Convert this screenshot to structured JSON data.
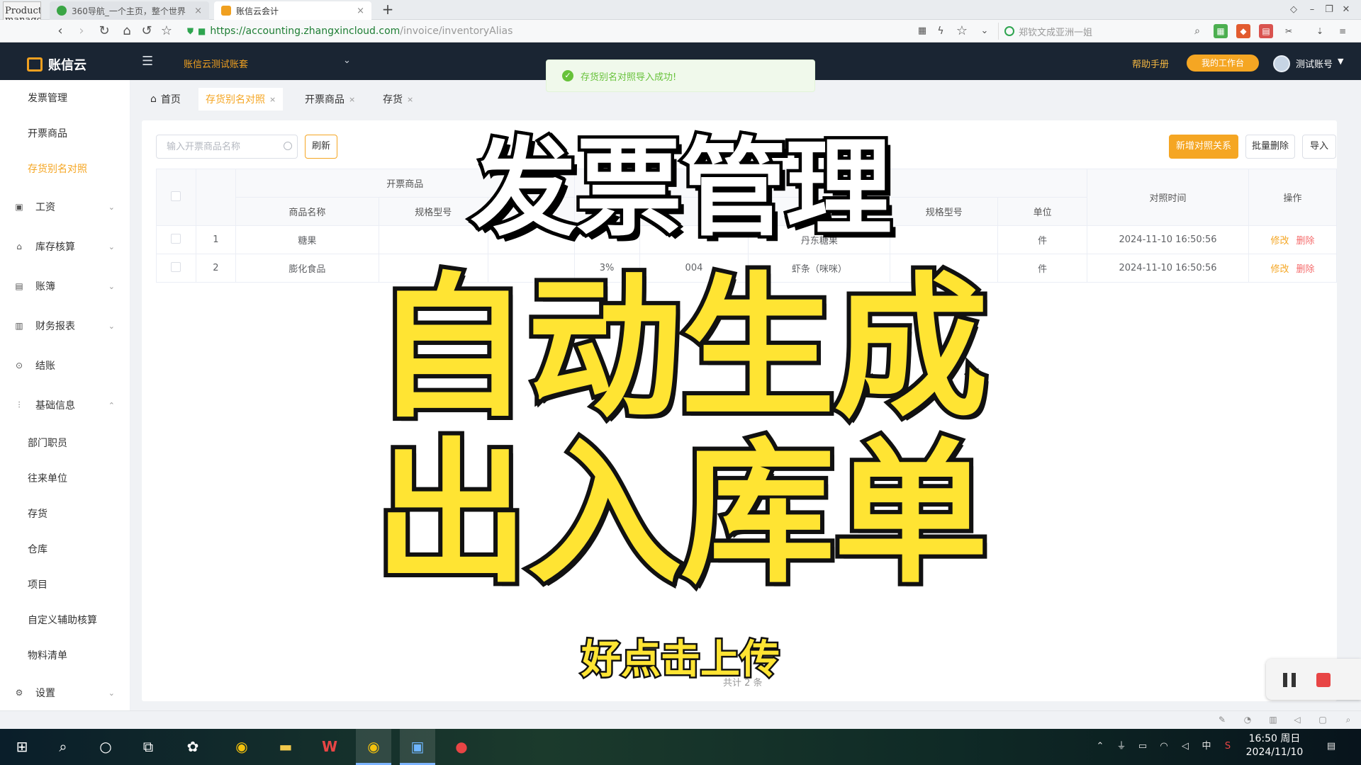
{
  "browser": {
    "thumb_text": "Product management",
    "tabs": [
      {
        "title": "360导航_一个主页，整个世界",
        "close": "×"
      },
      {
        "title": "账信云会计",
        "close": "×"
      }
    ],
    "new_tab": "+",
    "url_host": "https://accounting.zhangxincloud.com",
    "url_path": "/invoice/inventoryAlias",
    "search_hint": "郑钦文成亚洲一姐"
  },
  "app": {
    "logo": "账信云",
    "account_set": "账信云测试账套",
    "help": "帮助手册",
    "workbench": "我的工作台",
    "user": "测试账号",
    "toast": "存货别名对照导入成功!"
  },
  "sidebar": {
    "items": [
      {
        "label": "发票管理",
        "type": "sub"
      },
      {
        "label": "开票商品",
        "type": "sub"
      },
      {
        "label": "存货别名对照",
        "type": "sub",
        "active": true
      },
      {
        "label": "工资",
        "type": "group",
        "icon": "wage-icon"
      },
      {
        "label": "库存核算",
        "type": "group",
        "icon": "inventory-icon"
      },
      {
        "label": "账簿",
        "type": "group",
        "icon": "ledger-icon"
      },
      {
        "label": "财务报表",
        "type": "group",
        "icon": "report-icon"
      },
      {
        "label": "结账",
        "type": "group",
        "icon": "lock-icon"
      },
      {
        "label": "基础信息",
        "type": "group",
        "icon": "basic-info-icon"
      },
      {
        "label": "部门职员",
        "type": "sub"
      },
      {
        "label": "往来单位",
        "type": "sub"
      },
      {
        "label": "存货",
        "type": "sub"
      },
      {
        "label": "仓库",
        "type": "sub"
      },
      {
        "label": "项目",
        "type": "sub"
      },
      {
        "label": "自定义辅助核算",
        "type": "sub"
      },
      {
        "label": "物料清单",
        "type": "sub"
      },
      {
        "label": "设置",
        "type": "group",
        "icon": "settings-icon"
      }
    ]
  },
  "page_tabs": {
    "home": "首页",
    "alias": "存货别名对照",
    "invoice_goods": "开票商品",
    "inventory": "存货",
    "close": "×"
  },
  "toolbar": {
    "search_placeholder": "输入开票商品名称",
    "refresh": "刷新",
    "new_mapping": "新增对照关系",
    "bulk_delete": "批量删除",
    "import": "导入"
  },
  "table": {
    "group_header": "开票商品",
    "headers": {
      "name": "商品名称",
      "spec": "规格型号",
      "spec2": "规格型号",
      "unit": "单位",
      "time": "对照时间",
      "ops": "操作"
    },
    "rows": [
      {
        "idx": "1",
        "name": "糖果",
        "rate": "",
        "code": "",
        "inv_name": "丹东糖果",
        "unit": "件",
        "time": "2024-11-10 16:50:56",
        "edit": "修改",
        "del": "删除"
      },
      {
        "idx": "2",
        "name": "膨化食品",
        "rate": "3%",
        "code": "004",
        "inv_name": "虾条（咪咪）",
        "unit": "件",
        "time": "2024-11-10 16:50:56",
        "edit": "修改",
        "del": "删除"
      }
    ],
    "footer_partial": "共计 2 条"
  },
  "overlay": {
    "line1": "发票管理",
    "line2": "自动生成",
    "line3": "出入库单",
    "subtitle": "好点击上传"
  },
  "taskbar": {
    "time": "16:50 周日",
    "date": "2024/11/10",
    "ime": "中"
  }
}
